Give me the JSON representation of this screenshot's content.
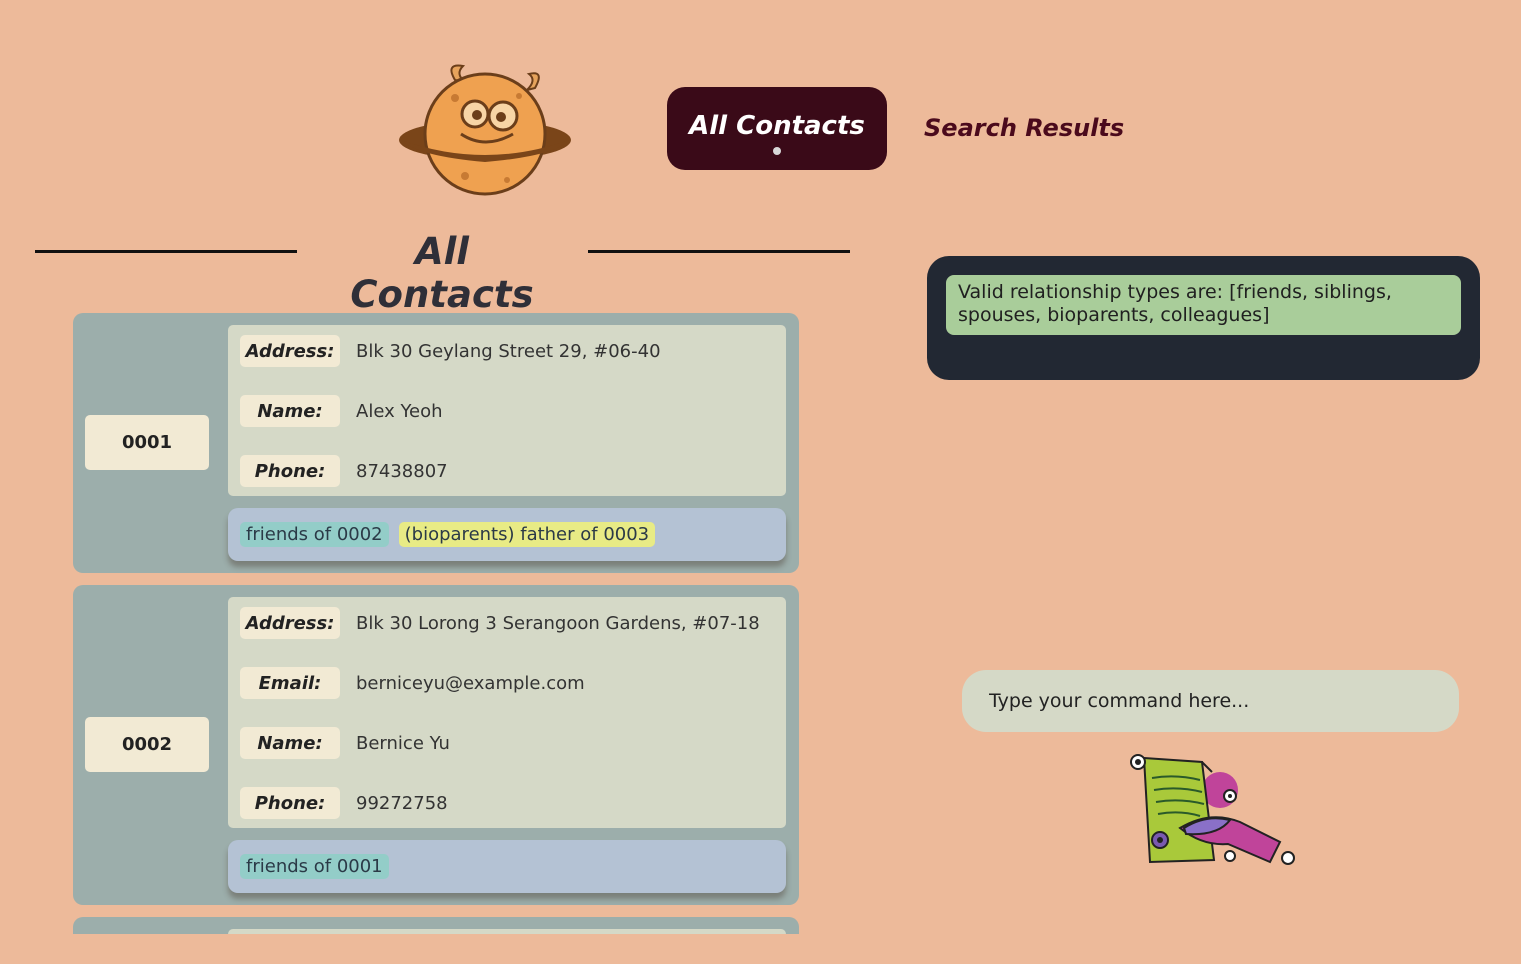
{
  "header": {
    "logo_icon": "planet-cookie-monster-icon",
    "tabs": [
      {
        "label": "All Contacts",
        "active": true
      },
      {
        "label": "Search Results",
        "active": false
      }
    ]
  },
  "list": {
    "title": "All Contacts",
    "contacts": [
      {
        "id": "0001",
        "fields": [
          {
            "label": "Address:",
            "value": "Blk 30 Geylang Street 29, #06-40"
          },
          {
            "label": "Name:",
            "value": "Alex Yeoh"
          },
          {
            "label": "Phone:",
            "value": "87438807"
          }
        ],
        "tags": [
          {
            "text": "friends of 0002",
            "color": "#93cdc8"
          },
          {
            "text": "(bioparents) father of 0003",
            "color": "#e8eb85"
          }
        ]
      },
      {
        "id": "0002",
        "fields": [
          {
            "label": "Address:",
            "value": "Blk 30 Lorong 3 Serangoon Gardens, #07-18"
          },
          {
            "label": "Email:",
            "value": "berniceyu@example.com"
          },
          {
            "label": "Name:",
            "value": "Bernice Yu"
          },
          {
            "label": "Phone:",
            "value": "99272758"
          }
        ],
        "tags": [
          {
            "text": "friends of 0001",
            "color": "#93cdc8"
          }
        ]
      }
    ]
  },
  "result": {
    "message": "Valid relationship types are: [friends, siblings, spouses, bioparents, colleagues]"
  },
  "command": {
    "placeholder": "Type your command here..."
  },
  "mascot_icon": "document-signing-monster-icon",
  "colors": {
    "background": "#edba9a",
    "active_tab": "#3a0a18",
    "card": "#9caeab",
    "result_panel": "#222833",
    "result_message": "#a9cd9a"
  }
}
